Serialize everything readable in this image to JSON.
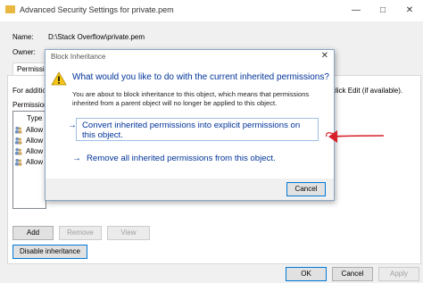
{
  "window": {
    "title": "Advanced Security Settings for private.pem",
    "minimize_label": "—",
    "maximize_label": "□",
    "close_label": "✕"
  },
  "props": {
    "name_label": "Name:",
    "name_value": "D:\\Stack Overflow\\private.pem",
    "owner_label": "Owner:"
  },
  "tabs": [
    "Permissio"
  ],
  "panel": {
    "info_left": "For additio",
    "info_right": "l click Edit (if available).",
    "entries_label": "Permission",
    "type_header": "Type",
    "rows": [
      "Allow",
      "Allow",
      "Allow",
      "Allow"
    ]
  },
  "buttons": {
    "add": "Add",
    "remove": "Remove",
    "view": "View",
    "disable_inheritance": "Disable inheritance",
    "ok": "OK",
    "cancel": "Cancel",
    "apply": "Apply"
  },
  "dialog": {
    "title": "Block Inheritance",
    "close": "✕",
    "question": "What would you like to do with the current inherited permissions?",
    "body": "You are about to block inheritance to this object, which means that permissions inherited from a parent object will no longer be applied to this object.",
    "option1": "Convert inherited permissions into explicit permissions on this object.",
    "option2": "Remove all inherited permissions from this object.",
    "arrow_glyph": "→",
    "cancel": "Cancel"
  },
  "colors": {
    "link": "#003399",
    "annotation_arrow": "#d8202a"
  }
}
